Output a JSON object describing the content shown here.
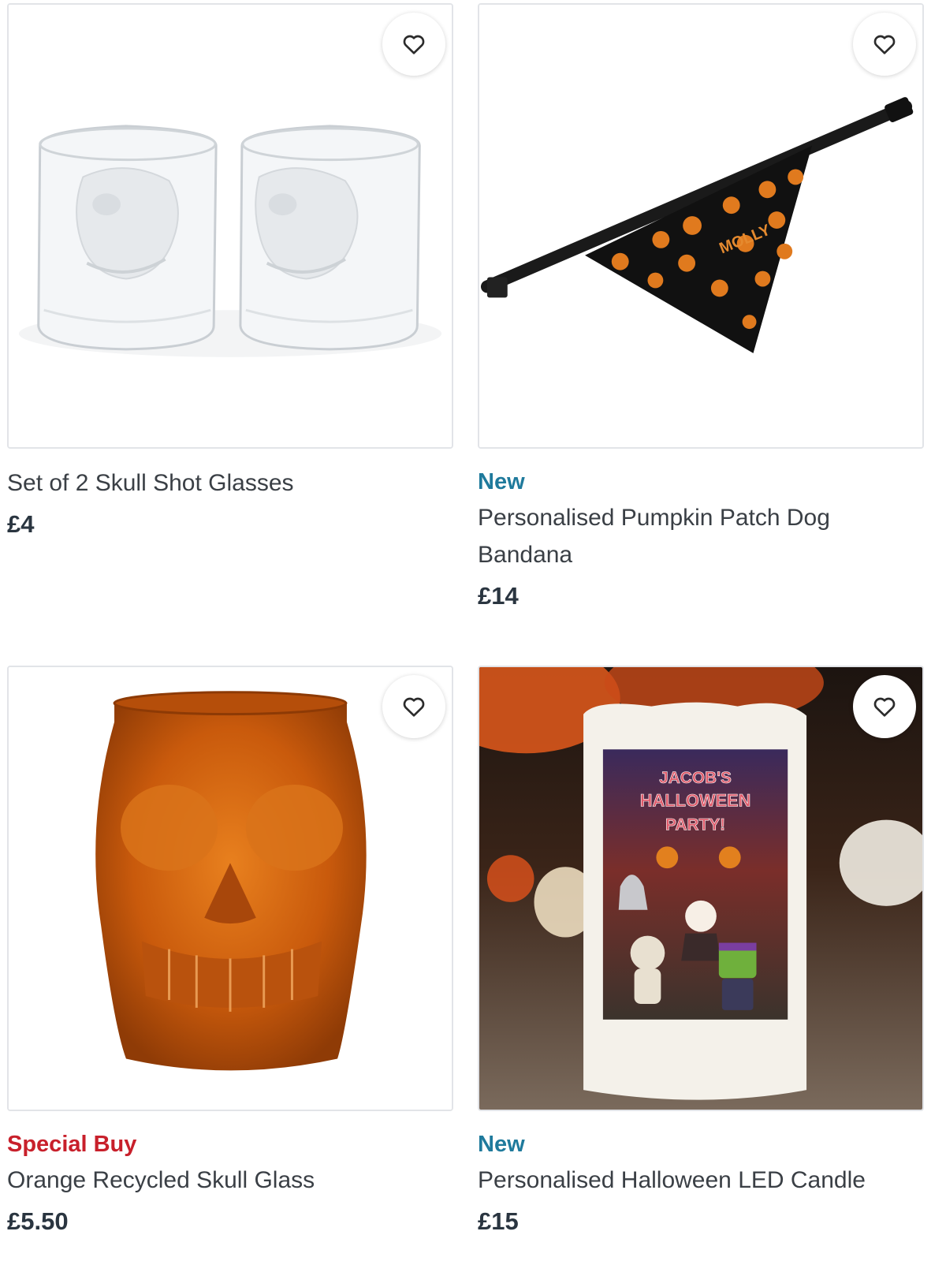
{
  "products": [
    {
      "badge": "",
      "title": "Set of 2 Skull Shot Glasses",
      "price": "£4",
      "image_icon": "skull-shot-glasses-image"
    },
    {
      "badge": "New",
      "title": "Personalised Pumpkin Patch Dog Bandana",
      "price": "£14",
      "image_icon": "dog-bandana-image",
      "image_text": "MOLLY"
    },
    {
      "badge": "Special Buy",
      "title": "Orange Recycled Skull Glass",
      "price": "£5.50",
      "image_icon": "orange-skull-glass-image"
    },
    {
      "badge": "New",
      "title": "Personalised Halloween LED Candle",
      "price": "£15",
      "image_icon": "halloween-candle-image",
      "image_text_lines": [
        "JACOB'S",
        "HALLOWEEN",
        "PARTY!"
      ]
    }
  ],
  "colors": {
    "badge_new": "#1f7a9c",
    "badge_special": "#c8202b",
    "price": "#2a3540"
  },
  "icons": {
    "favourite": "heart-outline-icon"
  }
}
